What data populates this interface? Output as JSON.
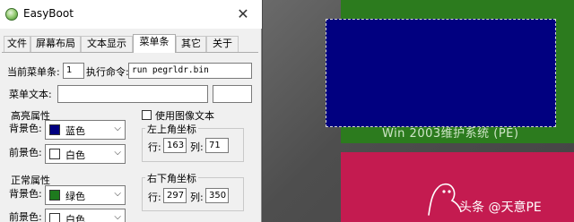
{
  "window": {
    "title": "EasyBoot"
  },
  "tabs": [
    {
      "label": "文件"
    },
    {
      "label": "屏幕布局"
    },
    {
      "label": "文本显示"
    },
    {
      "label": "菜单条"
    },
    {
      "label": "其它"
    },
    {
      "label": "关于"
    }
  ],
  "menu_bar": {
    "current_label": "当前菜单条:",
    "current_value": "1",
    "command_label": "执行命令:",
    "command_value": "run pegrldr.bin",
    "text_label": "菜单文本:",
    "text_value": "",
    "extra_value": ""
  },
  "highlight": {
    "title": "高亮属性",
    "bg_label": "背景色:",
    "bg_value": "蓝色",
    "bg_color": "#010080",
    "fg_label": "前景色:",
    "fg_value": "白色",
    "fg_color": "#ffffff"
  },
  "normal": {
    "title": "正常属性",
    "bg_label": "背景色:",
    "bg_value": "绿色",
    "bg_color": "#1e7a1e",
    "fg_label": "前景色:",
    "fg_value": "白色",
    "fg_color": "#ffffff"
  },
  "use_image_text": {
    "label": "使用图像文本",
    "checked": false
  },
  "top_left": {
    "title": "左上角坐标",
    "row_label": "行:",
    "row_value": "163",
    "col_label": "列:",
    "col_value": "71"
  },
  "bottom_right": {
    "title": "右下角坐标",
    "row_label": "行:",
    "row_value": "297",
    "col_label": "列:",
    "col_value": "350"
  },
  "preview": {
    "subtitle": "Win 2003维护系统 (PE)",
    "watermark": "头条 @天意PE",
    "colors": {
      "green": "#2c7b1e",
      "blue": "#010080",
      "red": "#c41b50"
    }
  }
}
